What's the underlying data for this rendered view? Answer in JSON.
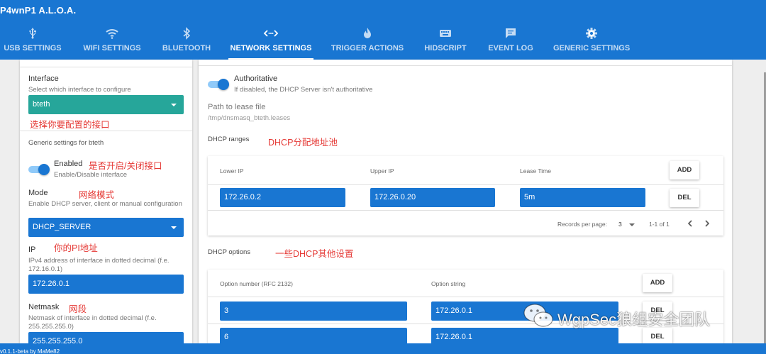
{
  "app": {
    "title": "P4wnP1 A.L.O.A.",
    "footer": "v0.1.1-beta by MaMe82"
  },
  "colors": {
    "primary": "#1976d2",
    "teal": "#26a69a",
    "annotation": "#e53935"
  },
  "tabs": [
    {
      "label": "USB SETTINGS",
      "icon": "usb-icon"
    },
    {
      "label": "WIFI SETTINGS",
      "icon": "wifi-icon"
    },
    {
      "label": "BLUETOOTH",
      "icon": "bluetooth-icon"
    },
    {
      "label": "NETWORK SETTINGS",
      "icon": "code-arrows-icon",
      "active": true
    },
    {
      "label": "TRIGGER ACTIONS",
      "icon": "flame-icon"
    },
    {
      "label": "HIDSCRIPT",
      "icon": "keyboard-icon"
    },
    {
      "label": "EVENT LOG",
      "icon": "message-icon"
    },
    {
      "label": "GENERIC SETTINGS",
      "icon": "gear-icon"
    }
  ],
  "left": {
    "interface": {
      "label": "Interface",
      "hint": "Select which interface to configure",
      "value": "bteth",
      "note": "选择你要配置的接口"
    },
    "generic_title": "Generic settings for bteth",
    "enabled": {
      "label": "Enabled",
      "hint": "Enable/Disable interface",
      "note": "是否开启/关闭接口",
      "on": true
    },
    "mode": {
      "label": "Mode",
      "hint": "Enable DHCP server, client or manual configuration",
      "value": "DHCP_SERVER",
      "note": "网络模式"
    },
    "ip": {
      "label": "IP",
      "hint": "IPv4 address of interface in dotted decimal (f.e. 172.16.0.1)",
      "value": "172.26.0.1",
      "note": "你的PI地址"
    },
    "netmask": {
      "label": "Netmask",
      "hint": "Netmask of interface in dotted decimal (f.e. 255.255.255.0)",
      "value": "255.255.255.0",
      "note": "网段"
    }
  },
  "right": {
    "authoritative": {
      "label": "Authoritative",
      "hint": "If disabled, the DHCP Server isn't authoritative",
      "on": true
    },
    "lease": {
      "label": "Path to lease file",
      "value": "/tmp/dnsmasq_bteth.leases"
    },
    "ranges": {
      "title": "DHCP ranges",
      "note": "DHCP分配地址池",
      "headers": [
        "Lower IP",
        "Upper IP",
        "Lease Time"
      ],
      "rows": [
        {
          "lower": "172.26.0.2",
          "upper": "172.26.0.20",
          "lease": "5m"
        }
      ],
      "add_label": "ADD",
      "del_label": "DEL",
      "footer": {
        "records_label": "Records per page:",
        "records_value": "3",
        "range": "1-1 of 1"
      }
    },
    "options": {
      "title": "DHCP options",
      "note": "一些DHCP其他设置",
      "headers": [
        "Option number (RFC 2132)",
        "Option string"
      ],
      "rows": [
        {
          "number": "3",
          "value": "172.26.0.1"
        },
        {
          "number": "6",
          "value": "172.26.0.1"
        }
      ],
      "add_label": "ADD",
      "del_label": "DEL"
    }
  },
  "watermark": {
    "text": "WgpSec狼组安全团队",
    "icon": "wechat-icon"
  }
}
